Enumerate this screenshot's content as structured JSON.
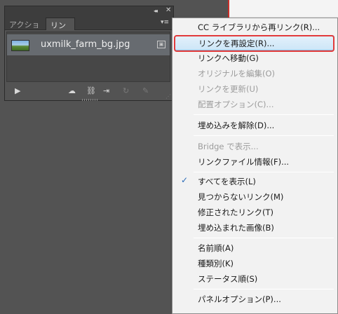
{
  "panel": {
    "tabs": [
      {
        "label": "アクション"
      },
      {
        "label": "リンク"
      }
    ],
    "collapse_glyph": "◂◂",
    "close_glyph": "✕",
    "menu_glyph": "▾≡",
    "link_row": {
      "filename": "uxmilk_farm_bg.jpg"
    }
  },
  "context_menu": {
    "items": [
      {
        "label": "CC ライブラリから再リンク(R)...",
        "enabled": true
      },
      {
        "label": "リンクを再設定(R)...",
        "enabled": true,
        "selected": true
      },
      {
        "label": "リンクへ移動(G)",
        "enabled": true
      },
      {
        "label": "オリジナルを編集(O)",
        "enabled": false
      },
      {
        "label": "リンクを更新(U)",
        "enabled": false
      },
      {
        "label": "配置オプション(C)...",
        "enabled": false
      },
      {
        "label": "埋め込みを解除(D)...",
        "enabled": true
      },
      {
        "label": "Bridge で表示...",
        "enabled": false
      },
      {
        "label": "リンクファイル情報(F)...",
        "enabled": true
      },
      {
        "label": "すべてを表示(L)",
        "enabled": true,
        "checked": true
      },
      {
        "label": "見つからないリンク(M)",
        "enabled": true
      },
      {
        "label": "修正されたリンク(T)",
        "enabled": true
      },
      {
        "label": "埋め込まれた画像(B)",
        "enabled": true
      },
      {
        "label": "名前順(A)",
        "enabled": true
      },
      {
        "label": "種類別(K)",
        "enabled": true
      },
      {
        "label": "ステータス順(S)",
        "enabled": true
      },
      {
        "label": "パネルオプション(P)...",
        "enabled": true
      }
    ],
    "check_glyph": "✓"
  },
  "colors": {
    "highlight_outline": "#e23b3b",
    "selected_bg": "#cde6f7",
    "panel_bg": "#535353",
    "menu_bg": "#f2f2f2"
  }
}
